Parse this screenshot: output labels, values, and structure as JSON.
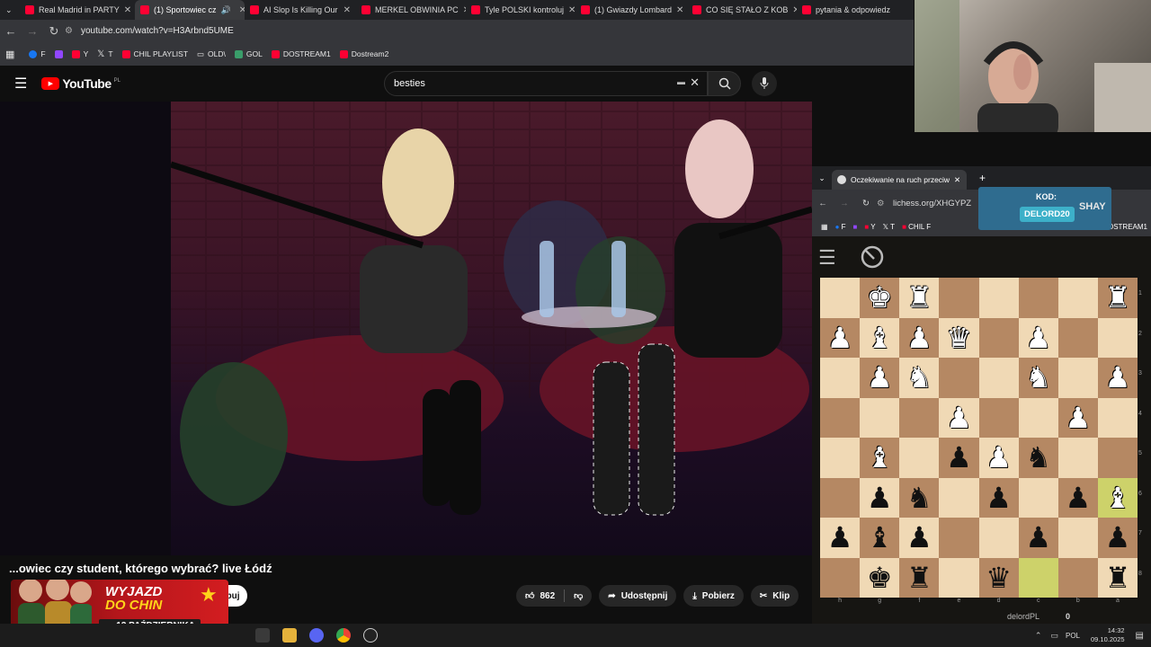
{
  "browser": {
    "tabs": [
      {
        "label": "Real Madrid in PARTY"
      },
      {
        "label": "(1) Sportowiec cz"
      },
      {
        "label": "AI Slop Is Killing Our"
      },
      {
        "label": "MERKEL OBWINIA PC"
      },
      {
        "label": "Tyle POLSKI kontroluj"
      },
      {
        "label": "(1) Gwiazdy Lombard"
      },
      {
        "label": "CO SIĘ STAŁO Z KOB"
      },
      {
        "label": "pytania & odpowiedz"
      }
    ],
    "url": "youtube.com/watch?v=H3Arbnd5UME",
    "bookmarks": [
      {
        "label": "F"
      },
      {
        "label": "Y"
      },
      {
        "label": "T"
      },
      {
        "label": "CHIL PLAYLIST"
      },
      {
        "label": "OLD\\"
      },
      {
        "label": "GOL"
      },
      {
        "label": "DOSTREAM1"
      },
      {
        "label": "Dostream2"
      }
    ]
  },
  "youtube": {
    "logo": "YouTube",
    "region": "PL",
    "search_value": "besties",
    "video_title": "...owiec czy student, którego wybrać? live Łódź",
    "subscribe_label": "ybuj",
    "likes": "862",
    "share_label": "Udostępnij",
    "download_label": "Pobierz",
    "clip_label": "Klip"
  },
  "banner": {
    "line1": "WYJAZD",
    "line2": "DO CHIN",
    "date_prefix": "OD",
    "date": "13 PAŹDZIERNIKA"
  },
  "chess_browser": {
    "tab_label": "Oczekiwanie na ruch przeciwni",
    "url": "lichess.org/XHGYPZ",
    "bookmarks": [
      "F",
      "Y",
      "T",
      "CHIL F",
      "DOSTREAM1"
    ],
    "overlay_code_label": "KOD:",
    "overlay_code": "DELORD20",
    "overlay_brand": "SHAY"
  },
  "chess": {
    "files": [
      "h",
      "g",
      "f",
      "e",
      "d",
      "c",
      "b",
      "a"
    ],
    "ranks": [
      "1",
      "2",
      "3",
      "4",
      "5",
      "6",
      "7",
      "8"
    ],
    "player": "delordPL",
    "score": "0",
    "board": [
      [
        "",
        "wK",
        "wR",
        "",
        "",
        "",
        "",
        "wR"
      ],
      [
        "wP",
        "wB",
        "wP",
        "wQ",
        "",
        "wP",
        "",
        ""
      ],
      [
        "",
        "wP",
        "wN",
        "",
        "",
        "wN",
        "",
        "wP"
      ],
      [
        "",
        "",
        "",
        "wP",
        "",
        "",
        "wP",
        ""
      ],
      [
        "",
        "wB",
        "",
        "bP",
        "wP",
        "bN",
        "",
        ""
      ],
      [
        "",
        "bP",
        "bN",
        "",
        "bP",
        "",
        "bP",
        "wB"
      ],
      [
        "bP",
        "bB",
        "bP",
        "",
        "",
        "bP",
        "",
        "bP"
      ],
      [
        "",
        "bK",
        "bR",
        "",
        "bQ",
        "",
        "",
        "bR"
      ]
    ],
    "highlight": [
      [
        5,
        7
      ],
      [
        7,
        5
      ]
    ]
  },
  "taskbar": {
    "lang": "POL",
    "time": "14:32",
    "date": "09.10.2025"
  }
}
